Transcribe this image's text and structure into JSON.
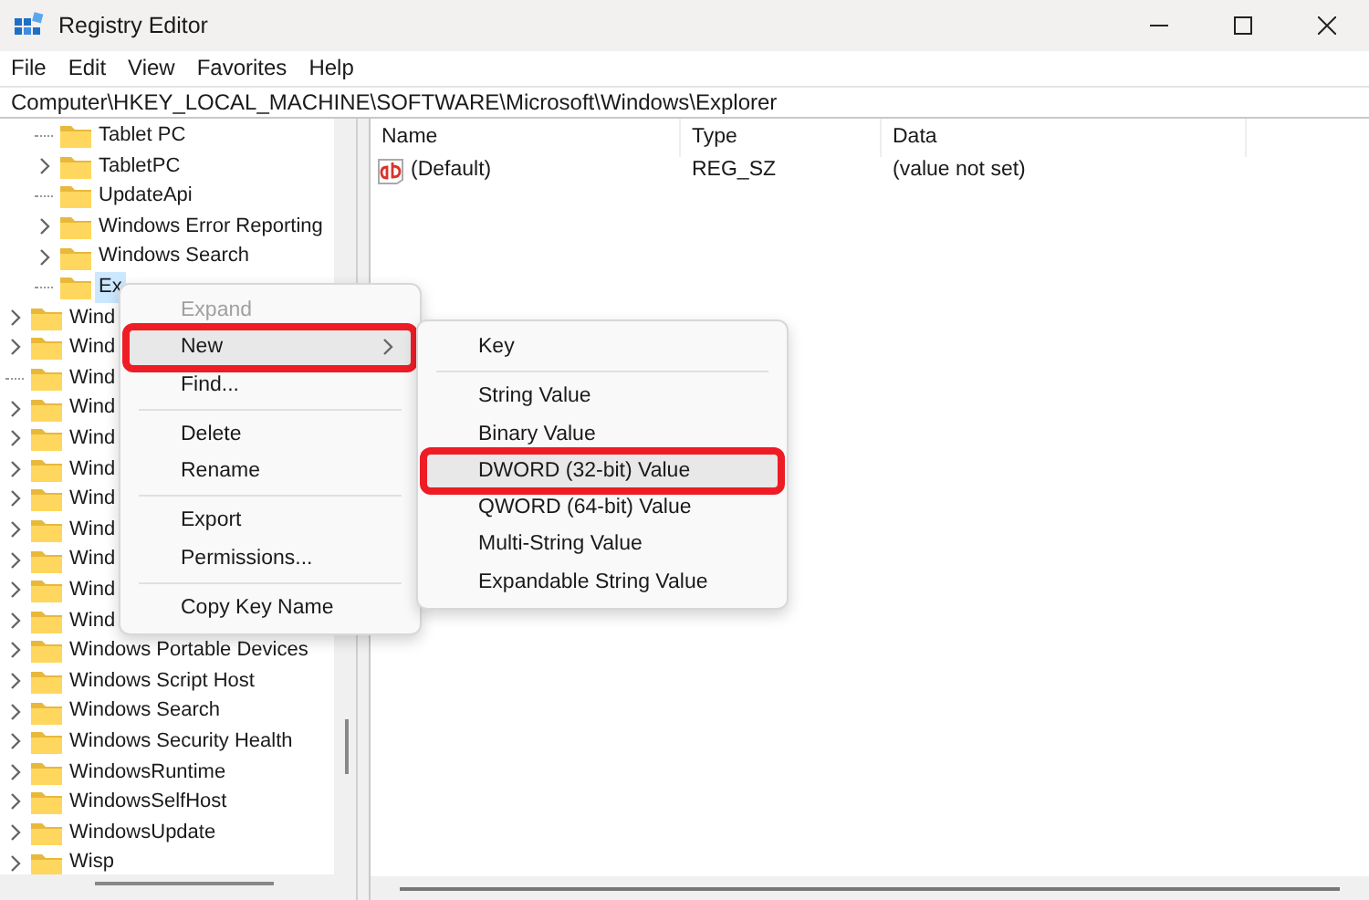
{
  "window": {
    "title": "Registry Editor"
  },
  "menu_bar": [
    "File",
    "Edit",
    "View",
    "Favorites",
    "Help"
  ],
  "address_bar": {
    "value": "Computer\\HKEY_LOCAL_MACHINE\\SOFTWARE\\Microsoft\\Windows\\Explorer"
  },
  "tree": {
    "child_items": [
      {
        "label": "Tablet PC",
        "has_children": false,
        "selected": false
      },
      {
        "label": "TabletPC",
        "has_children": true,
        "selected": false
      },
      {
        "label": "UpdateApi",
        "has_children": false,
        "selected": false
      },
      {
        "label": "Windows Error Reporting",
        "has_children": true,
        "selected": false
      },
      {
        "label": "Windows Search",
        "has_children": true,
        "selected": false
      },
      {
        "label": "Ex",
        "has_children": false,
        "selected": true
      }
    ],
    "items": [
      {
        "label": "Wind",
        "has_children": true,
        "selected": false
      },
      {
        "label": "Wind",
        "has_children": true,
        "selected": false
      },
      {
        "label": "Wind",
        "has_children": false,
        "selected": false
      },
      {
        "label": "Wind",
        "has_children": true,
        "selected": false
      },
      {
        "label": "Wind",
        "has_children": true,
        "selected": false
      },
      {
        "label": "Wind",
        "has_children": true,
        "selected": false
      },
      {
        "label": "Wind",
        "has_children": true,
        "selected": false
      },
      {
        "label": "Wind",
        "has_children": true,
        "selected": false
      },
      {
        "label": "Wind",
        "has_children": true,
        "selected": false
      },
      {
        "label": "Wind",
        "has_children": true,
        "selected": false
      },
      {
        "label": "Wind",
        "has_children": true,
        "selected": false
      },
      {
        "label": "Windows Portable Devices",
        "has_children": true,
        "selected": false
      },
      {
        "label": "Windows Script Host",
        "has_children": true,
        "selected": false
      },
      {
        "label": "Windows Search",
        "has_children": true,
        "selected": false
      },
      {
        "label": "Windows Security Health",
        "has_children": true,
        "selected": false
      },
      {
        "label": "WindowsRuntime",
        "has_children": true,
        "selected": false
      },
      {
        "label": "WindowsSelfHost",
        "has_children": true,
        "selected": false
      },
      {
        "label": "WindowsUpdate",
        "has_children": true,
        "selected": false
      },
      {
        "label": "Wisp",
        "has_children": true,
        "selected": false
      }
    ]
  },
  "values_table": {
    "columns": [
      "Name",
      "Type",
      "Data"
    ],
    "rows": [
      {
        "name": "(Default)",
        "type": "REG_SZ",
        "data": "(value not set)"
      }
    ]
  },
  "context_menu": {
    "items": [
      {
        "kind": "item",
        "label": "Expand",
        "disabled": true,
        "highlighted": false,
        "annotated": false,
        "has_submenu": false
      },
      {
        "kind": "item",
        "label": "New",
        "disabled": false,
        "highlighted": true,
        "annotated": true,
        "has_submenu": true
      },
      {
        "kind": "item",
        "label": "Find...",
        "disabled": false,
        "highlighted": false,
        "annotated": false,
        "has_submenu": false
      },
      {
        "kind": "separator"
      },
      {
        "kind": "item",
        "label": "Delete",
        "disabled": false,
        "highlighted": false,
        "annotated": false,
        "has_submenu": false
      },
      {
        "kind": "item",
        "label": "Rename",
        "disabled": false,
        "highlighted": false,
        "annotated": false,
        "has_submenu": false
      },
      {
        "kind": "separator"
      },
      {
        "kind": "item",
        "label": "Export",
        "disabled": false,
        "highlighted": false,
        "annotated": false,
        "has_submenu": false
      },
      {
        "kind": "item",
        "label": "Permissions...",
        "disabled": false,
        "highlighted": false,
        "annotated": false,
        "has_submenu": false
      },
      {
        "kind": "separator"
      },
      {
        "kind": "item",
        "label": "Copy Key Name",
        "disabled": false,
        "highlighted": false,
        "annotated": false,
        "has_submenu": false
      }
    ]
  },
  "submenu": {
    "items": [
      {
        "kind": "item",
        "label": "Key",
        "highlighted": false,
        "annotated": false
      },
      {
        "kind": "separator"
      },
      {
        "kind": "item",
        "label": "String Value",
        "highlighted": false,
        "annotated": false
      },
      {
        "kind": "item",
        "label": "Binary Value",
        "highlighted": false,
        "annotated": false
      },
      {
        "kind": "item",
        "label": "DWORD (32-bit) Value",
        "highlighted": true,
        "annotated": true
      },
      {
        "kind": "item",
        "label": "QWORD (64-bit) Value",
        "highlighted": false,
        "annotated": false
      },
      {
        "kind": "item",
        "label": "Multi-String Value",
        "highlighted": false,
        "annotated": false
      },
      {
        "kind": "item",
        "label": "Expandable String Value",
        "highlighted": false,
        "annotated": false
      }
    ]
  }
}
